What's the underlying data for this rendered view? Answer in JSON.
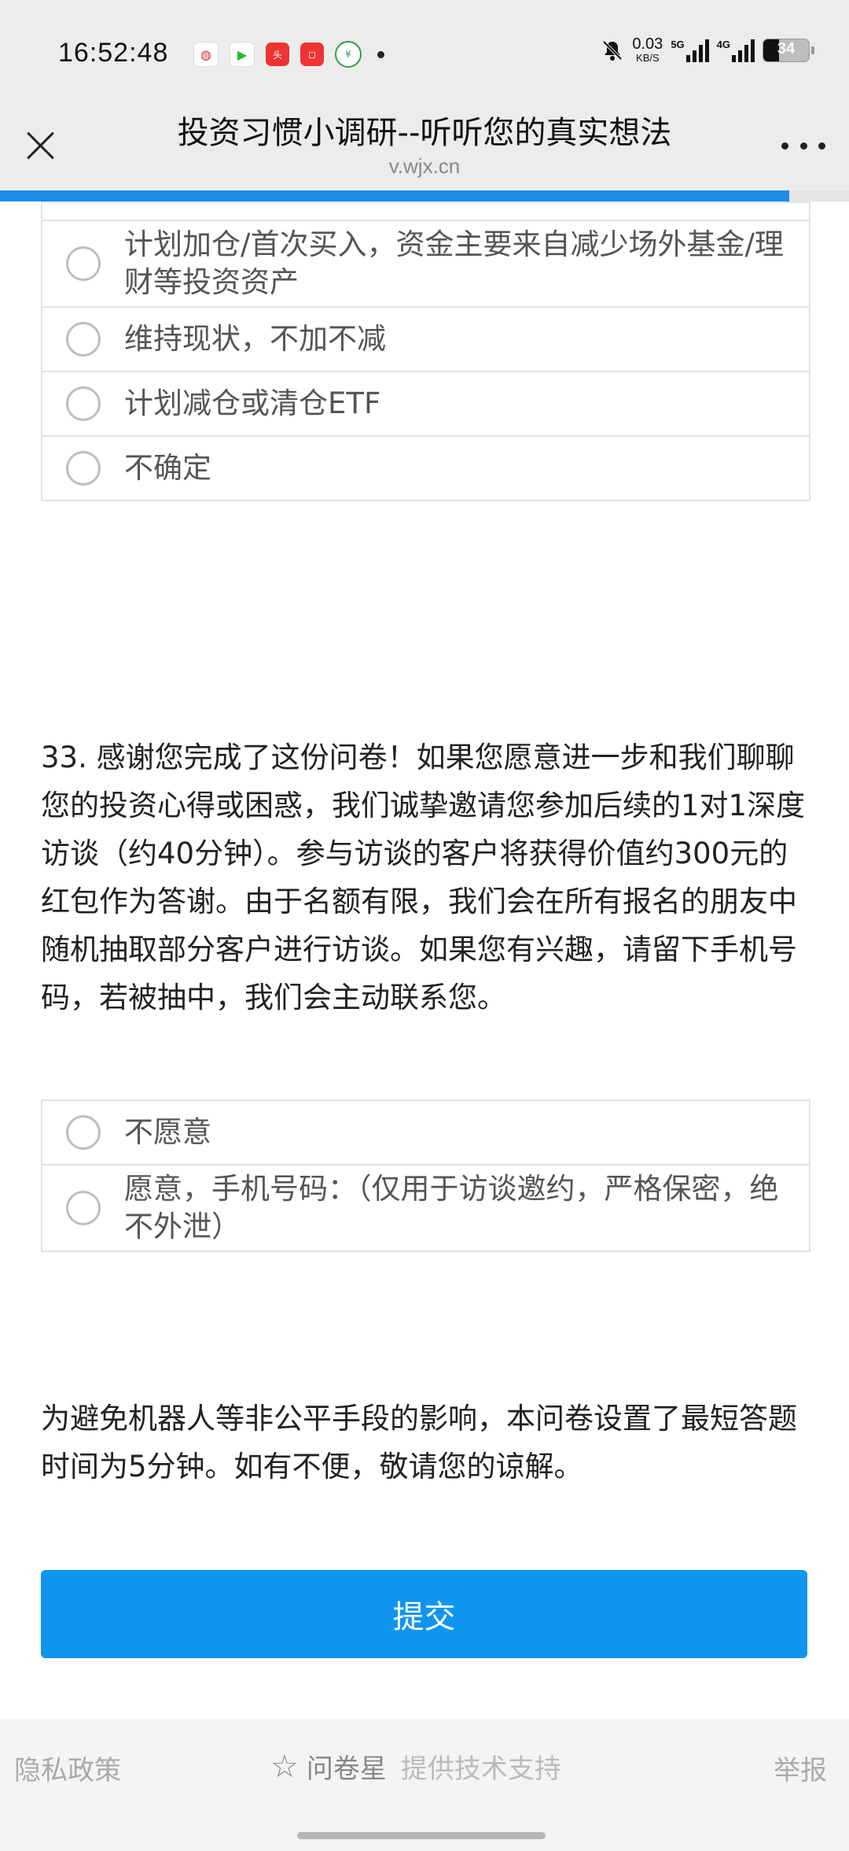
{
  "status_bar": {
    "time": "16:52:48",
    "network_speed_value": "0.03",
    "network_speed_unit": "KB/S",
    "signal_1_label": "5G",
    "signal_2_label": "4G",
    "battery_level": "34",
    "notification_icons": [
      "app-icon-1",
      "app-icon-2",
      "toutiao-icon",
      "app-icon-4",
      "bank-icon"
    ]
  },
  "nav": {
    "title": "投资习惯小调研--听听您的真实想法",
    "url": "v.wjx.cn",
    "progress_fraction": 0.93
  },
  "question_32": {
    "options": [
      {
        "label": "计划加仓/首次买入，资金主要来自减少场外基金/理财等投资资产"
      },
      {
        "label": "维持现状，不加不减"
      },
      {
        "label": "计划减仓或清仓ETF"
      },
      {
        "label": "不确定"
      }
    ]
  },
  "question_33": {
    "text": "33. 感谢您完成了这份问卷！如果您愿意进一步和我们聊聊您的投资心得或困惑，我们诚挚邀请您参加后续的1对1深度访谈（约40分钟）。参与访谈的客户将获得价值约300元的红包作为答谢。由于名额有限，我们会在所有报名的朋友中随机抽取部分客户进行访谈。如果您有兴趣，请留下手机号码，若被抽中，我们会主动联系您。",
    "options": [
      {
        "label": "不愿意"
      },
      {
        "label": "愿意，手机号码：（仅用于访谈邀约，严格保密，绝不外泄）"
      }
    ]
  },
  "notice": "为避免机器人等非公平手段的影响，本问卷设置了最短答题时间为5分钟。如有不便，敬请您的谅解。",
  "submit_label": "提交",
  "footer": {
    "privacy": "隐私政策",
    "brand": "问卷星",
    "brand_sub": "提供技术支持",
    "report": "举报"
  },
  "colors": {
    "accent": "#0f95f0",
    "progress": "#1f8ceb",
    "header_bg": "#ececec"
  }
}
